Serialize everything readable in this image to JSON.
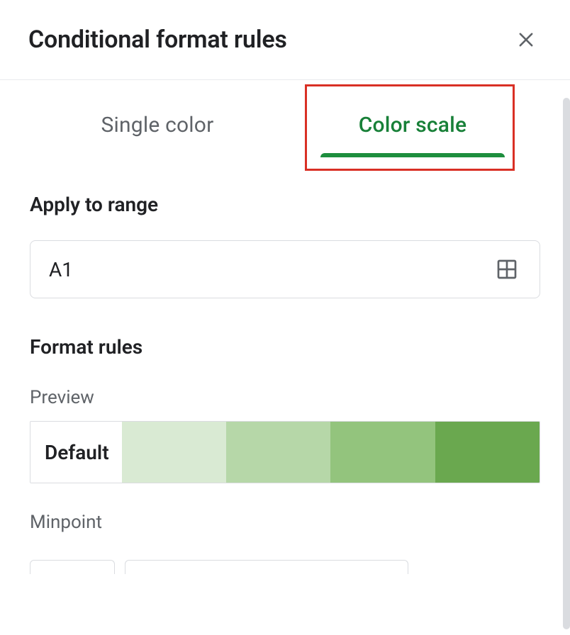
{
  "header": {
    "title": "Conditional format rules"
  },
  "tabs": {
    "single_color": "Single color",
    "color_scale": "Color scale"
  },
  "range": {
    "section_title": "Apply to range",
    "value": "A1"
  },
  "format_rules": {
    "section_title": "Format rules",
    "preview_label": "Preview",
    "preview_default": "Default",
    "preview_colors": [
      "#d9ead3",
      "#b6d7a8",
      "#93c47d",
      "#6aa84f"
    ],
    "minpoint_label": "Minpoint"
  },
  "accent_color": "#188038",
  "highlight_color": "#d93025"
}
